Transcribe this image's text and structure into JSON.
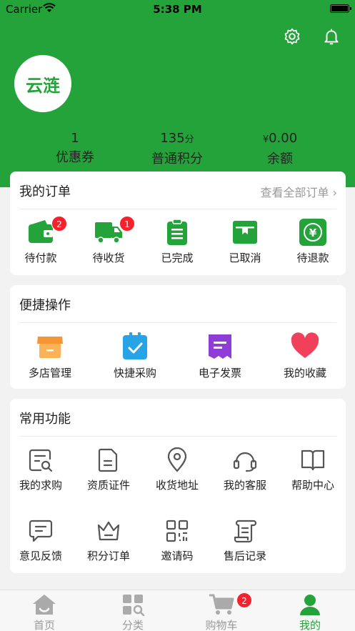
{
  "status_bar": {
    "carrier": "Carrier",
    "time": "5:38 PM"
  },
  "header": {
    "logo_text": "云涟",
    "stats": [
      {
        "value": "1",
        "unit": "",
        "label": "优惠券"
      },
      {
        "value": "135",
        "unit": "分",
        "label": "普通积分"
      },
      {
        "value": "0.00",
        "unit": "¥",
        "label": "余额"
      }
    ]
  },
  "orders": {
    "title": "我的订单",
    "view_all": "查看全部订单 ›",
    "items": [
      {
        "label": "待付款",
        "icon": "wallet-icon",
        "badge": "2"
      },
      {
        "label": "待收货",
        "icon": "truck-icon",
        "badge": "1"
      },
      {
        "label": "已完成",
        "icon": "clipboard-icon",
        "badge": ""
      },
      {
        "label": "已取消",
        "icon": "box-icon",
        "badge": ""
      },
      {
        "label": "待退款",
        "icon": "refund-icon",
        "badge": ""
      }
    ]
  },
  "shortcuts": {
    "title": "便捷操作",
    "items": [
      {
        "label": "多店管理",
        "icon": "store-icon"
      },
      {
        "label": "快捷采购",
        "icon": "purchase-icon"
      },
      {
        "label": "电子发票",
        "icon": "invoice-icon"
      },
      {
        "label": "我的收藏",
        "icon": "heart-icon"
      }
    ]
  },
  "functions": {
    "title": "常用功能",
    "items": [
      {
        "label": "我的求购",
        "icon": "search-doc-icon"
      },
      {
        "label": "资质证件",
        "icon": "document-icon"
      },
      {
        "label": "收货地址",
        "icon": "location-icon"
      },
      {
        "label": "我的客服",
        "icon": "headset-icon"
      },
      {
        "label": "帮助中心",
        "icon": "book-icon"
      },
      {
        "label": "意见反馈",
        "icon": "feedback-icon"
      },
      {
        "label": "积分订单",
        "icon": "crown-icon"
      },
      {
        "label": "邀请码",
        "icon": "qrcode-icon"
      },
      {
        "label": "售后记录",
        "icon": "scroll-icon"
      }
    ]
  },
  "tabbar": {
    "items": [
      {
        "label": "首页",
        "icon": "home-icon"
      },
      {
        "label": "分类",
        "icon": "category-icon"
      },
      {
        "label": "购物车",
        "icon": "cart-icon",
        "badge": "2"
      },
      {
        "label": "我的",
        "icon": "user-icon"
      }
    ]
  },
  "colors": {
    "brand": "#25a33b",
    "badge": "#f5222d"
  }
}
